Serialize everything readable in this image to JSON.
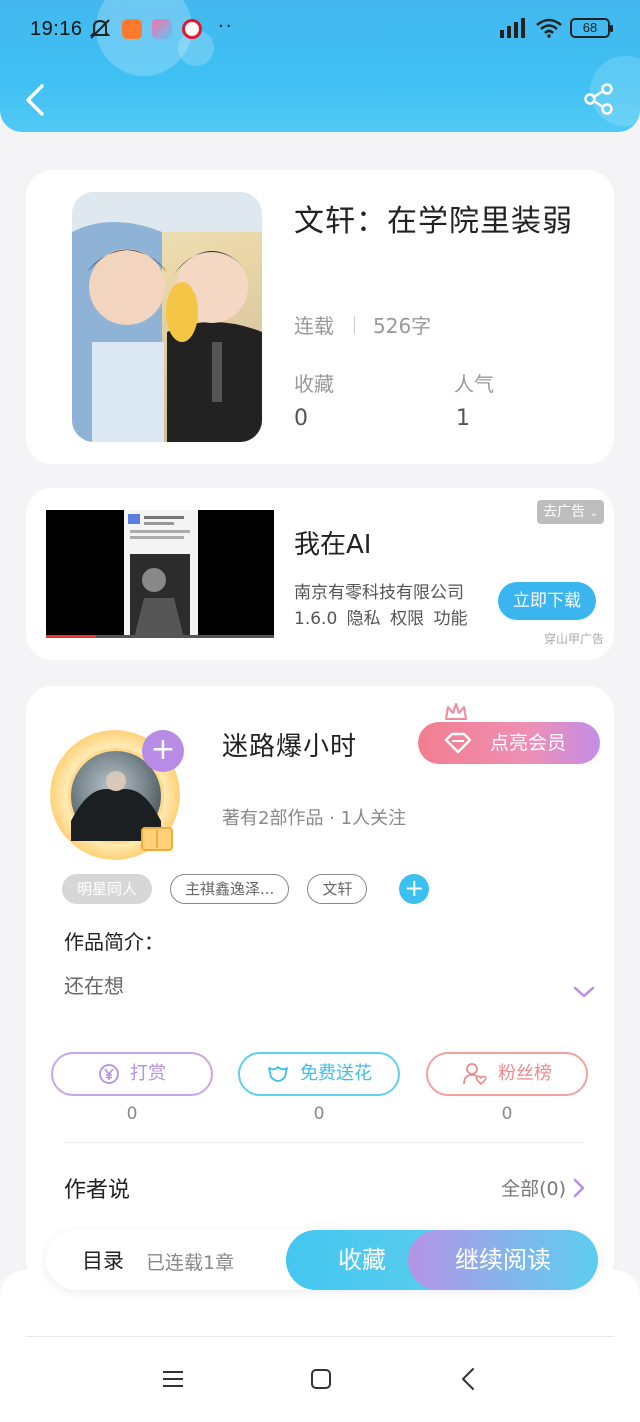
{
  "status_bar": {
    "time": "19:16",
    "dots": "··",
    "battery": "68"
  },
  "book": {
    "title": "文轩：在学院里装弱",
    "status": "连载",
    "word_count": "526字",
    "favorites_label": "收藏",
    "favorites_value": "0",
    "popularity_label": "人气",
    "popularity_value": "1"
  },
  "ad": {
    "title": "我在AI",
    "company": "南京有零科技有限公司",
    "meta": "1.6.0 隐私 权限 功能",
    "remove_label": "去广告",
    "download_label": "立即下载",
    "source": "穿山甲广告"
  },
  "author": {
    "name": "迷路爆小时",
    "meta": "著有2部作品 · 1人关注",
    "vip_label": "点亮会员",
    "tags": [
      "明星同人",
      "主祺鑫逸泽...",
      "文轩"
    ]
  },
  "intro": {
    "label": "作品简介：",
    "text": "还在想"
  },
  "actions": [
    {
      "label": "打赏",
      "count": "0"
    },
    {
      "label": "免费送花",
      "count": "0"
    },
    {
      "label": "粉丝榜",
      "count": "0"
    }
  ],
  "author_say": {
    "label": "作者说",
    "all_label": "全部(0)"
  },
  "read_bar": {
    "toc_label": "目录",
    "chapters": "已连载1章",
    "collect_label": "收藏",
    "continue_label": "继续阅读"
  },
  "colors": {
    "header": "#3fc0f3",
    "accent_blue": "#3bc0ef",
    "accent_purple": "#b590e2",
    "accent_pink": "#ef8a8a"
  },
  "icons": [
    "back-icon",
    "share-icon",
    "plus-icon",
    "crown-icon",
    "diamond-icon",
    "yuan-icon",
    "flower-icon",
    "fans-icon",
    "chevron-down-icon",
    "chevron-right-icon",
    "menu-icon",
    "home-icon",
    "back-nav-icon"
  ]
}
